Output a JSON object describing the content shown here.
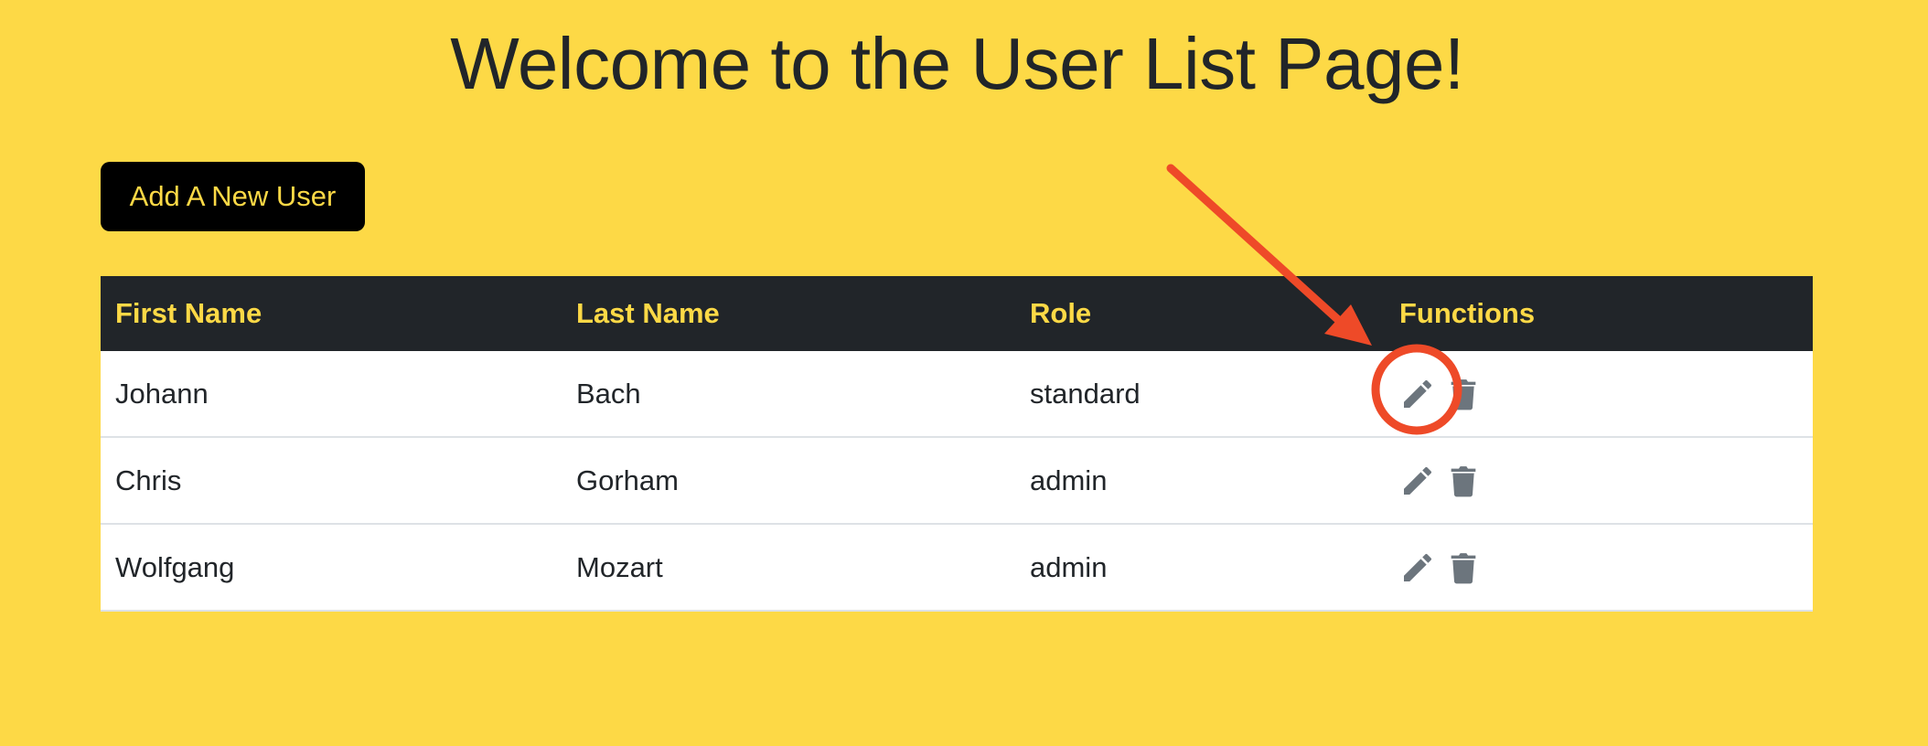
{
  "page": {
    "title": "Welcome to the User List Page!"
  },
  "toolbar": {
    "add_user_label": "Add A New User"
  },
  "table": {
    "headers": [
      "First Name",
      "Last Name",
      "Role",
      "Functions"
    ],
    "rows": [
      {
        "first_name": "Johann",
        "last_name": "Bach",
        "role": "standard"
      },
      {
        "first_name": "Chris",
        "last_name": "Gorham",
        "role": "admin"
      },
      {
        "first_name": "Wolfgang",
        "last_name": "Mozart",
        "role": "admin"
      }
    ],
    "row_actions": [
      "pencil-icon",
      "trash-icon"
    ]
  },
  "colors": {
    "background": "#FDD946",
    "header_bg": "#212529",
    "header_text": "#FDD946",
    "button_bg": "#000000",
    "button_text": "#FDD946",
    "icon": "#6C757D",
    "annotation": "#EE4A28"
  }
}
